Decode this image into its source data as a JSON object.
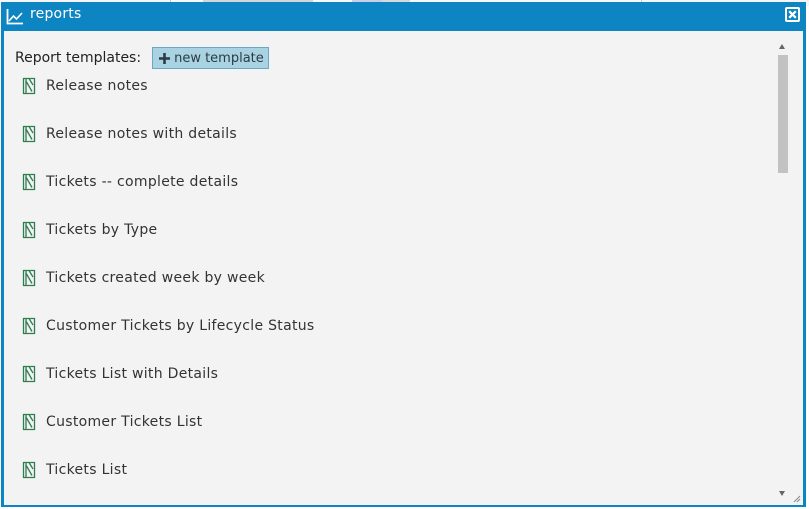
{
  "window": {
    "title": "reports",
    "title_icon": "chart-line-icon",
    "close_icon": "close-icon"
  },
  "header": {
    "label": "Report templates:",
    "new_button_label": "new template",
    "new_button_icon": "plus-icon"
  },
  "templates": [
    {
      "label": "Release notes",
      "icon": "report-template-icon"
    },
    {
      "label": "Release notes with details",
      "icon": "report-template-icon"
    },
    {
      "label": "Tickets -- complete details",
      "icon": "report-template-icon"
    },
    {
      "label": "Tickets by Type",
      "icon": "report-template-icon"
    },
    {
      "label": "Tickets created week by week",
      "icon": "report-template-icon"
    },
    {
      "label": "Customer Tickets by Lifecycle Status",
      "icon": "report-template-icon"
    },
    {
      "label": "Tickets List with Details",
      "icon": "report-template-icon"
    },
    {
      "label": "Customer Tickets List",
      "icon": "report-template-icon"
    },
    {
      "label": "Tickets List",
      "icon": "report-template-icon"
    }
  ],
  "colors": {
    "titlebar": "#0d85c2",
    "content_bg": "#f3f3f3",
    "button_bg": "#a9d3e3",
    "icon_green": "#2e7d4f"
  }
}
